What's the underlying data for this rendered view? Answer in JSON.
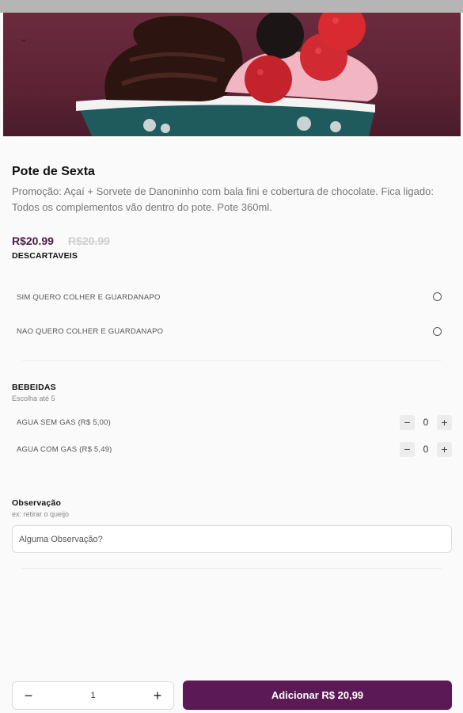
{
  "product": {
    "title": "Pote de Sexta",
    "description": "Promoção: Açaí + Sorvete de Danoninho com bala fini e cobertura de chocolate.  Fica ligado: Todos os complementos vão dentro do pote. Pote 360ml.",
    "price": "R$20.99",
    "old_price": "R$20.99"
  },
  "descartaveis": {
    "title": "DESCARTAVEIS",
    "options": [
      {
        "label": "SIM QUERO COLHER E GUARDANAPO"
      },
      {
        "label": "NAO QUERO COLHER E GUARDANAPO"
      }
    ]
  },
  "bebidas": {
    "title": "BEBEIDAS",
    "subtitle": "Escolha até 5",
    "items": [
      {
        "label": "AGUA SEM GAS (R$ 5,00)",
        "qty": "0"
      },
      {
        "label": "AGUA COM GAS (R$ 5,49)",
        "qty": "0"
      }
    ]
  },
  "observacao": {
    "title": "Observação",
    "hint": "ex: retirar o queijo",
    "placeholder": "Alguma Observação?"
  },
  "footer": {
    "quantity": "1",
    "add_label": "Adicionar R$ 20,99"
  },
  "icons": {
    "minus": "minus-icon",
    "plus": "plus-icon",
    "chevron": "chevron-down-icon"
  },
  "colors": {
    "brand": "#5b1a55",
    "price": "#4a1c45"
  }
}
